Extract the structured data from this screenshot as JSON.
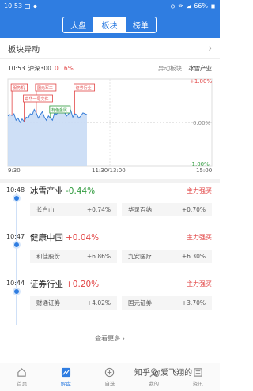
{
  "status_bar": {
    "time": "10:53",
    "battery": "66%"
  },
  "nav": {
    "tabs": [
      "大盘",
      "板块",
      "榜单"
    ],
    "active_index": 1
  },
  "section": {
    "title": "板块异动"
  },
  "chart_info": {
    "time": "10:53",
    "index_name": "沪深300",
    "index_change": "0.16%",
    "label": "异动板块",
    "sector": "冰雪产业"
  },
  "chart_data": {
    "type": "line",
    "x_labels": [
      "9:30",
      "11:30/13:00",
      "15:00"
    ],
    "y_labels": [
      "+1.00%",
      "0.00%",
      "-1.00%"
    ],
    "ylim": [
      -1.0,
      1.0
    ],
    "annotations": [
      "服务机",
      "国元军工",
      "中华一号文件",
      "有色金属",
      "证券行业"
    ],
    "series": [
      {
        "values": [
          0.15,
          0.18,
          0.16,
          0.2,
          0.05,
          0.1,
          0.0,
          0.08,
          0.02,
          0.12,
          0.1,
          0.2,
          0.18,
          0.3,
          0.22,
          0.1,
          0.18,
          0.25,
          0.12,
          0.05,
          0.15,
          0.1,
          0.05,
          0.22,
          0.18,
          0.3,
          0.25,
          0.35,
          0.22,
          0.15,
          0.2,
          0.28,
          0.12,
          0.2,
          0.18,
          0.1,
          0.15,
          0.22,
          0.2,
          0.18
        ]
      }
    ]
  },
  "timeline": [
    {
      "time": "10:48",
      "title": "冰雪产业",
      "change": "-0.44%",
      "dir": "down",
      "tag": "主力强买",
      "stocks": [
        {
          "name": "长白山",
          "value": "+0.74%"
        },
        {
          "name": "华录百纳",
          "value": "+0.70%"
        }
      ]
    },
    {
      "time": "10:47",
      "title": "健康中国",
      "change": "+0.04%",
      "dir": "up",
      "tag": "主力强买",
      "stocks": [
        {
          "name": "和佳股份",
          "value": "+6.86%"
        },
        {
          "name": "九安医疗",
          "value": "+6.30%"
        }
      ]
    },
    {
      "time": "10:44",
      "title": "证券行业",
      "change": "+0.20%",
      "dir": "up",
      "tag": "主力强买",
      "stocks": [
        {
          "name": "财通证券",
          "value": "+4.02%"
        },
        {
          "name": "国元证券",
          "value": "+3.70%"
        }
      ]
    }
  ],
  "more": {
    "label": "查看更多"
  },
  "bottom_nav": [
    "首页",
    "解盘",
    "自选",
    "我的",
    "资讯"
  ],
  "bottom_active": 1,
  "watermark": "知乎 @爱飞翔的"
}
